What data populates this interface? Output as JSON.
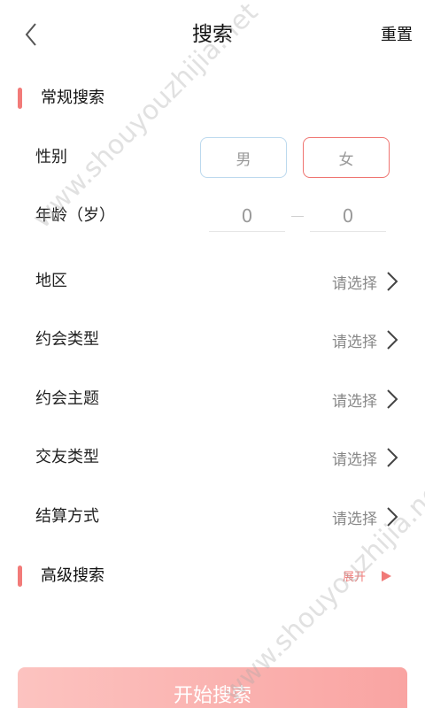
{
  "header": {
    "title": "搜索",
    "reset_label": "重置"
  },
  "basic": {
    "section_title": "常规搜索",
    "gender": {
      "label": "性别",
      "male": "男",
      "female": "女"
    },
    "age": {
      "label": "年龄（岁）",
      "min": "0",
      "max": "0"
    },
    "rows": [
      {
        "label": "地区",
        "value": "请选择"
      },
      {
        "label": "约会类型",
        "value": "请选择"
      },
      {
        "label": "约会主题",
        "value": "请选择"
      },
      {
        "label": "交友类型",
        "value": "请选择"
      },
      {
        "label": "结算方式",
        "value": "请选择"
      }
    ]
  },
  "advanced": {
    "section_title": "高级搜索",
    "expand_label": "展开"
  },
  "start_button": "开始搜索",
  "watermark": "www.shouyouzhijia.net",
  "colors": {
    "accent": "#f27b79",
    "male_border": "#bcd9ee",
    "female_border": "#ef7470",
    "button_gradient_start": "#fcc3c0",
    "button_gradient_end": "#f9a4a2"
  }
}
